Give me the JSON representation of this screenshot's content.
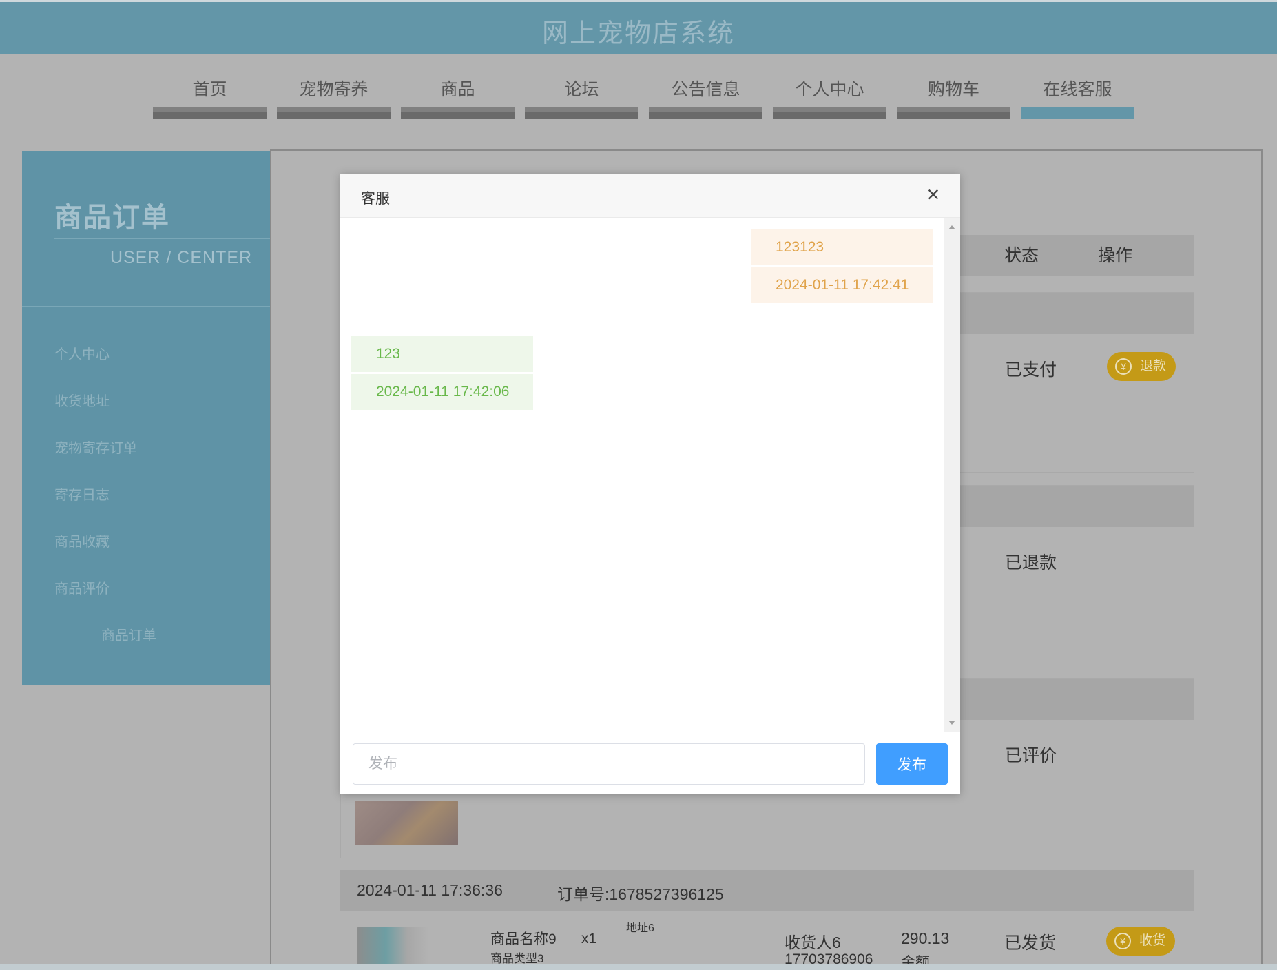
{
  "header": {
    "title": "网上宠物店系统"
  },
  "nav": {
    "items": [
      {
        "label": "首页"
      },
      {
        "label": "宠物寄养"
      },
      {
        "label": "商品"
      },
      {
        "label": "论坛"
      },
      {
        "label": "公告信息"
      },
      {
        "label": "个人中心"
      },
      {
        "label": "购物车"
      },
      {
        "label": "在线客服"
      }
    ],
    "active": "在线客服"
  },
  "sidebar": {
    "title": "商品订单",
    "subtitle": "USER / CENTER",
    "items": [
      {
        "label": "个人中心"
      },
      {
        "label": "收货地址"
      },
      {
        "label": "宠物寄存订单"
      },
      {
        "label": "寄存日志"
      },
      {
        "label": "商品收藏"
      },
      {
        "label": "商品评价"
      },
      {
        "label": "商品订单"
      }
    ]
  },
  "orders": {
    "headers": {
      "status": "状态",
      "action": "操作"
    },
    "rows": [
      {
        "status": "已支付",
        "action": "退款"
      },
      {
        "status": "已退款"
      },
      {
        "status": "已评价"
      }
    ],
    "last": {
      "time": "2024-01-11 17:36:36",
      "order_no": "订单号:1678527396125",
      "product_name": "商品名称9",
      "product_type": "商品类型3",
      "qty": "x1",
      "address": "地址6",
      "receiver": "收货人6",
      "phone": "17703786906",
      "price": "290.13",
      "amount_label": "金额",
      "status": "已发货",
      "action": "收货"
    },
    "currency_icon": "yen-circle-icon",
    "action_color": "#c49a17"
  },
  "modal": {
    "title": "客服",
    "messages": [
      {
        "side": "right",
        "text": "123123",
        "time": "2024-01-11 17:42:41"
      },
      {
        "side": "left",
        "text": "123",
        "time": "2024-01-11 17:42:06"
      }
    ],
    "input_placeholder": "发布",
    "send_label": "发布"
  },
  "colors": {
    "brand": "#6396a8",
    "send_button": "#409eff",
    "right_bubble": "#fdf3e9",
    "left_bubble": "#eef7ea"
  }
}
